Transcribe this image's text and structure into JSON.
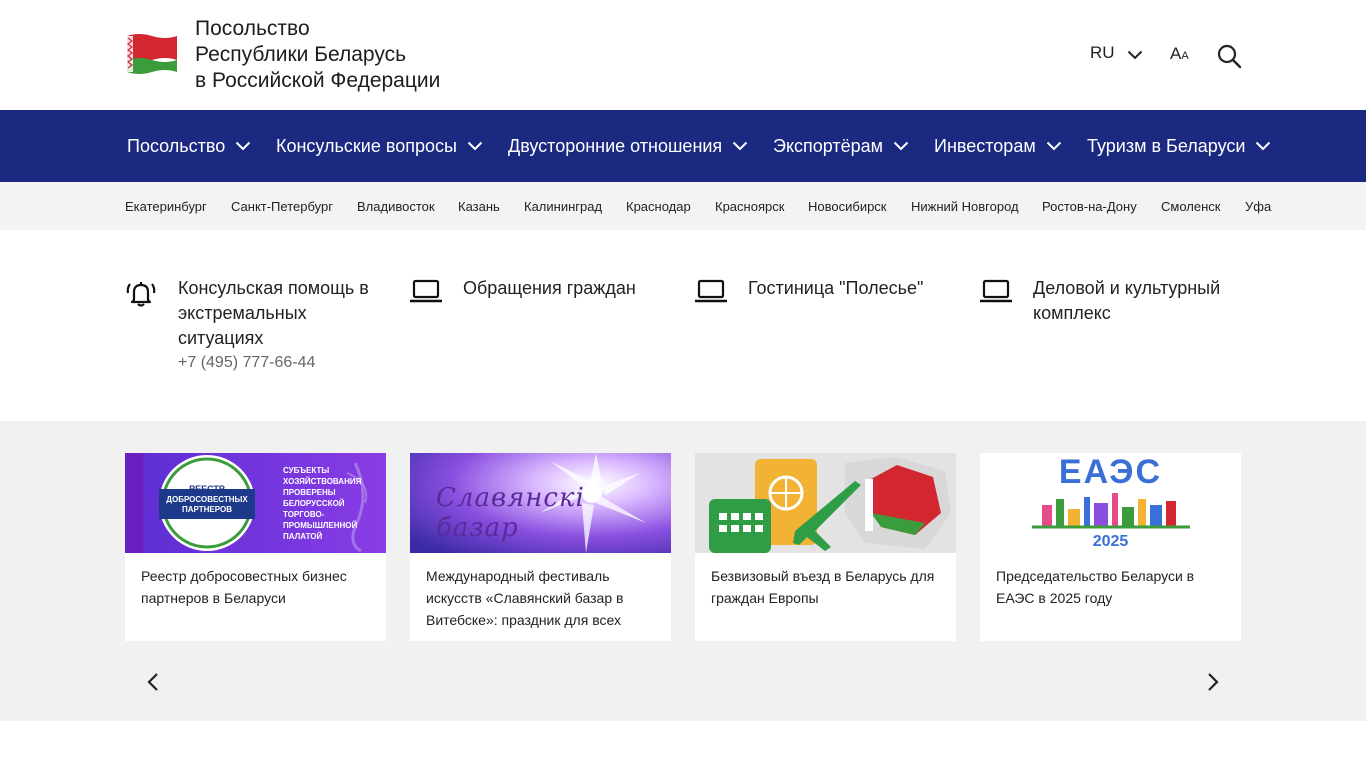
{
  "header": {
    "title_lines": [
      "Посольство",
      "Республики Беларусь",
      "в Российской Федерации"
    ],
    "lang": "RU",
    "font_size_label_big": "A",
    "font_size_label_small": "A"
  },
  "nav": {
    "items": [
      {
        "label": "Посольство"
      },
      {
        "label": "Консульские вопросы"
      },
      {
        "label": "Двусторонние отношения"
      },
      {
        "label": "Экспортёрам"
      },
      {
        "label": "Инвесторам"
      },
      {
        "label": "Туризм в Беларуси"
      }
    ]
  },
  "cities": [
    "Екатеринбург",
    "Санкт-Петербург",
    "Владивосток",
    "Казань",
    "Калининград",
    "Краснодар",
    "Красноярск",
    "Новосибирск",
    "Нижний Новгород",
    "Ростов-на-Дону",
    "Смоленск",
    "Уфа"
  ],
  "quick_links": [
    {
      "title": "Консульская помощь в экстремальных ситуациях",
      "phone": "+7 (495) 777-66-44",
      "icon": "bell-icon"
    },
    {
      "title": "Обращения граждан",
      "icon": "laptop-icon"
    },
    {
      "title": "Гостиница \"Полесье\"",
      "icon": "laptop-icon"
    },
    {
      "title": "Деловой и культурный комплекс",
      "icon": "laptop-icon"
    }
  ],
  "cards": [
    {
      "title": "Реестр добросовестных бизнес партнеров в Беларуси",
      "img_badge_lines": [
        "РЕЕСТР",
        "ДОБРОСОВЕСТНЫХ",
        "ПАРТНЕРОВ"
      ],
      "img_text_lines": [
        "СУБЪЕКТЫ",
        "ХОЗЯЙСТВОВАНИЯ",
        "ПРОВЕРЕНЫ",
        "БЕЛОРУССКОЙ",
        "ТОРГОВО-",
        "ПРОМЫШЛЕННОЙ",
        "ПАЛАТОЙ"
      ]
    },
    {
      "title": "Международный фестиваль искусств «Славянский базар в Витебске»: праздник для всех",
      "img_text": "Славянскі базар"
    },
    {
      "title": "Безвизовый въезд в Беларусь для граждан Европы"
    },
    {
      "title": "Председательство Беларуси в ЕАЭС в 2025 году",
      "img_top": "ЕАЭС",
      "img_year": "2025"
    }
  ],
  "colors": {
    "nav_bg": "#1b2a80",
    "flag_red": "#d22630",
    "flag_green": "#3a9c3b"
  }
}
